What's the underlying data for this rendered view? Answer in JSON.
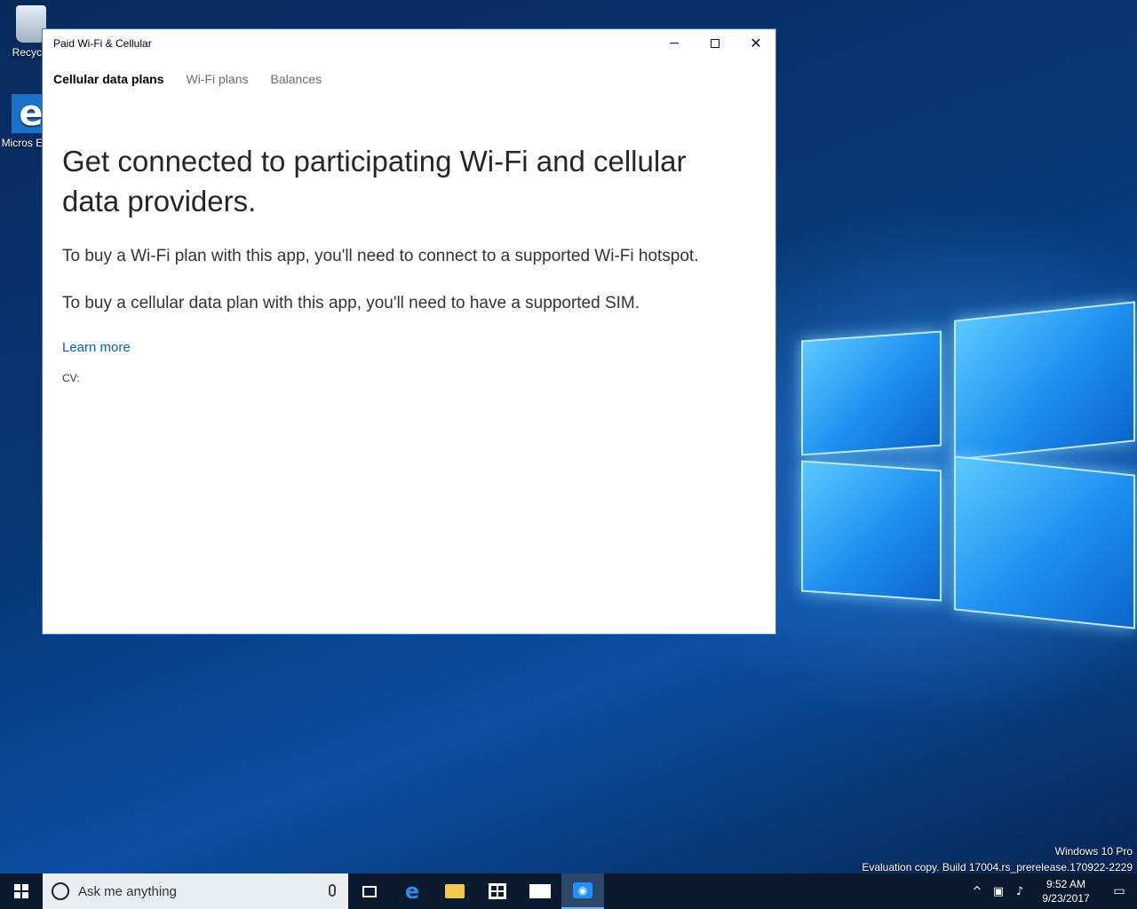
{
  "desktop": {
    "icons": [
      {
        "label": "Recycle"
      },
      {
        "label": "Micros Edge"
      }
    ],
    "watermark": {
      "line1": "Windows 10 Pro",
      "line2": "Evaluation copy. Build 17004.rs_prerelease.170922-2229"
    }
  },
  "window": {
    "title": "Paid Wi-Fi & Cellular",
    "tabs": [
      {
        "label": "Cellular data plans",
        "active": true
      },
      {
        "label": "Wi-Fi plans",
        "active": false
      },
      {
        "label": "Balances",
        "active": false
      }
    ],
    "headline": "Get connected to participating Wi-Fi and cellular data providers.",
    "para_wifi": "To buy a Wi-Fi plan with this app, you'll need to connect to a supported Wi-Fi hotspot.",
    "para_cellular": "To buy a cellular data plan with this app, you'll need to have a supported SIM.",
    "learn_more": "Learn more",
    "cv_label": "CV:"
  },
  "taskbar": {
    "search_placeholder": "Ask me anything",
    "clock_time": "9:52 AM",
    "clock_date": "9/23/2017",
    "icons": [
      "start-icon",
      "task-view-icon",
      "edge-icon",
      "file-explorer-icon",
      "store-icon",
      "mail-icon",
      "paid-wifi-app-icon"
    ]
  },
  "colors": {
    "accent_link": "#0063b1",
    "window_border": "#2b79d4",
    "taskbar_bg": "#0b1a2e"
  }
}
